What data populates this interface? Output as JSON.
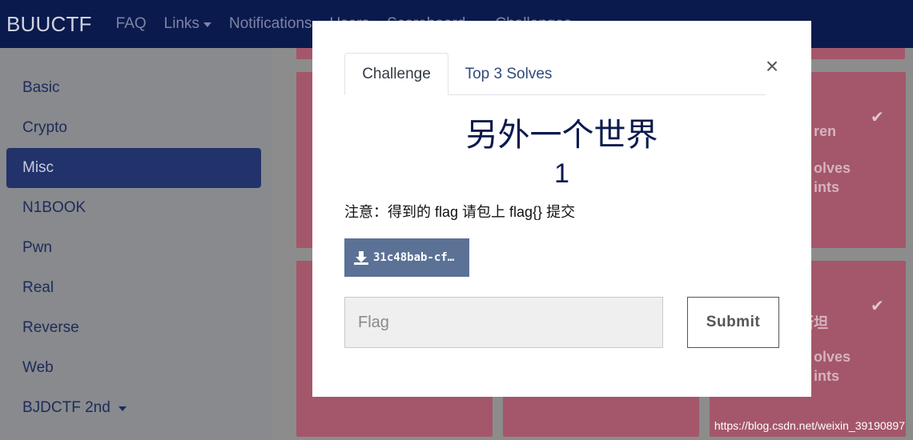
{
  "navbar": {
    "brand": "BUUCTF",
    "links": [
      {
        "label": "FAQ"
      },
      {
        "label": "Links"
      },
      {
        "label": "Notifications"
      },
      {
        "label": "Users"
      },
      {
        "label": "Scoreboard"
      },
      {
        "label": "Challenges"
      }
    ]
  },
  "sidebar": {
    "items": [
      {
        "label": "Basic"
      },
      {
        "label": "Crypto"
      },
      {
        "label": "Misc"
      },
      {
        "label": "N1BOOK"
      },
      {
        "label": "Pwn"
      },
      {
        "label": "Real"
      },
      {
        "label": "Reverse"
      },
      {
        "label": "Web"
      },
      {
        "label": "BJDCTF 2nd"
      }
    ],
    "active": "Misc"
  },
  "background_cards": {
    "card1": {
      "name_fragment": "ren",
      "solves_fragment": "olves",
      "points_fragment": "ints"
    },
    "card2": {
      "name_fragment": "断坦",
      "solves_fragment": "olves",
      "points_fragment": "ints"
    }
  },
  "modal": {
    "tabs": [
      {
        "label": "Challenge"
      },
      {
        "label": "Top 3 Solves"
      }
    ],
    "close_label": "×",
    "title": "另外一个世界",
    "points": "1",
    "description": "注意：得到的 flag 请包上 flag{} 提交",
    "file_label": "31c48bab-cf…",
    "flag_placeholder": "Flag",
    "submit_label": "Submit"
  },
  "watermark": "https://blog.csdn.net/weixin_39190897",
  "colors": {
    "navbar": "#0b1a4d",
    "active_sidebar": "#22326a",
    "card": "#a4576a",
    "file_button": "#5b7296"
  }
}
